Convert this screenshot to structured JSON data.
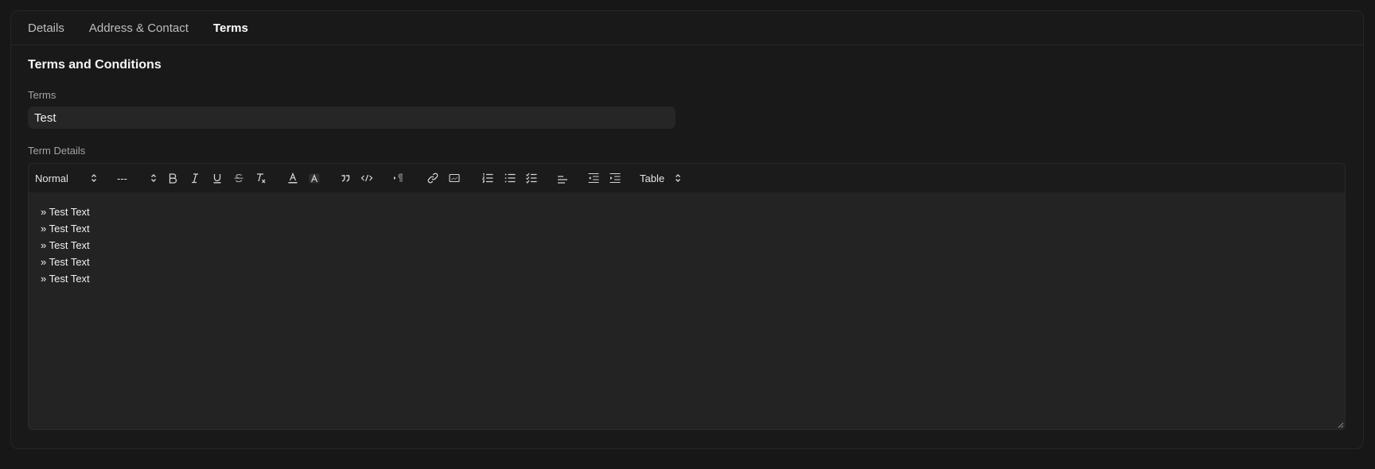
{
  "tabs": [
    {
      "label": "Details",
      "active": false
    },
    {
      "label": "Address & Contact",
      "active": false
    },
    {
      "label": "Terms",
      "active": true
    }
  ],
  "section": {
    "title": "Terms and Conditions"
  },
  "terms_field": {
    "label": "Terms",
    "value": "Test"
  },
  "details_field": {
    "label": "Term Details"
  },
  "toolbar": {
    "format_select": "Normal",
    "size_select": "---",
    "table_select": "Table",
    "icons": [
      "bold-icon",
      "italic-icon",
      "underline-icon",
      "strikethrough-icon",
      "clear-format-icon",
      "font-color-icon",
      "background-color-icon",
      "blockquote-icon",
      "code-block-icon",
      "text-direction-icon",
      "link-icon",
      "image-icon",
      "ordered-list-icon",
      "bullet-list-icon",
      "check-list-icon",
      "align-icon",
      "outdent-icon",
      "indent-icon"
    ]
  },
  "editor": {
    "lines": [
      "» Test Text",
      "» Test Text",
      "» Test Text",
      "» Test Text",
      "» Test Text"
    ]
  },
  "colors": {
    "background": "#171717",
    "card": "#191919",
    "input": "#262626",
    "editor": "#232323",
    "toolbar": "#1b1b1b"
  }
}
